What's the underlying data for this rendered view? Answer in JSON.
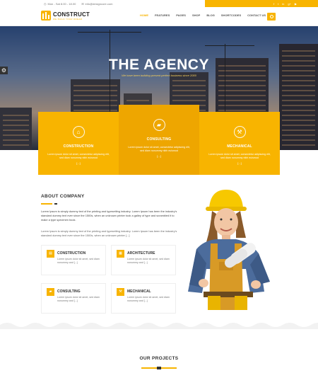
{
  "topbar": {
    "hours": "Mon - Sat 8.00 - 18.00",
    "email": "info@designcore.com",
    "social_icons": [
      "facebook-icon",
      "twitter-icon",
      "linkedin-icon",
      "google-plus-icon",
      "youtube-icon"
    ]
  },
  "header": {
    "logo_name": "CONSTRUCT",
    "logo_tagline": "WE BUILD YOUR DREAM",
    "nav": [
      "HOME",
      "FEATURES",
      "PAGES",
      "SHOP",
      "BLOG",
      "SHORTCODES",
      "CONTACT US"
    ]
  },
  "hero": {
    "title": "THE AGENCY",
    "subtitle": "We have been building present perfect business since 2000"
  },
  "cards": [
    {
      "title": "CONSTRUCTION",
      "text": "Lorem ipsum dolor sit amet, consectetur adipiscing elit, sed diam nonummy nibh euismod",
      "more": "[...]",
      "icon": "crane-icon"
    },
    {
      "title": "CONSULTING",
      "text": "Lorem ipsum dolor sit amet, consectetur adipiscing elit, sed diam nonummy nibh euismod",
      "more": "[...]",
      "icon": "truck-icon"
    },
    {
      "title": "MECHANICAL",
      "text": "Lorem ipsum dolor sit amet, consectetur adipiscing elit, sed diam nonummy nibh euismod",
      "more": "[...]",
      "icon": "wrench-icon"
    }
  ],
  "about": {
    "title": "ABOUT COMPANY",
    "p1": "Lorem Ipsum is simply dummy text of the printing and typesetting industry. Lorem Ipsum has been the industry's standard dummy text ever since the 1500s, when an unknown printer took a galley of type and scrambled it to make a type specimen book.",
    "p2": "Lorem Ipsum is simply dummy text of the printing and typesetting industry. Lorem Ipsum has been the industry's standard dummy text ever since the 1500s, when an unknown printer [...]"
  },
  "features": [
    {
      "title": "CONSTRUCTION",
      "text": "Lorem ipsum dolor sit amet, sed diam nonummy and [...]"
    },
    {
      "title": "ARCHITECTURE",
      "text": "Lorem ipsum dolor sit amet, sed diam nonummy and [...]"
    },
    {
      "title": "CONSULTING",
      "text": "Lorem ipsum dolor sit amet, sed diam nonummy and [...]"
    },
    {
      "title": "MECHANICAL",
      "text": "Lorem ipsum dolor sit amet, sed diam nonummy and [...]"
    }
  ],
  "projects": {
    "title": "OUR PROJECTS"
  },
  "colors": {
    "accent": "#f8b400",
    "accent_dark": "#eea600",
    "text": "#333333"
  }
}
